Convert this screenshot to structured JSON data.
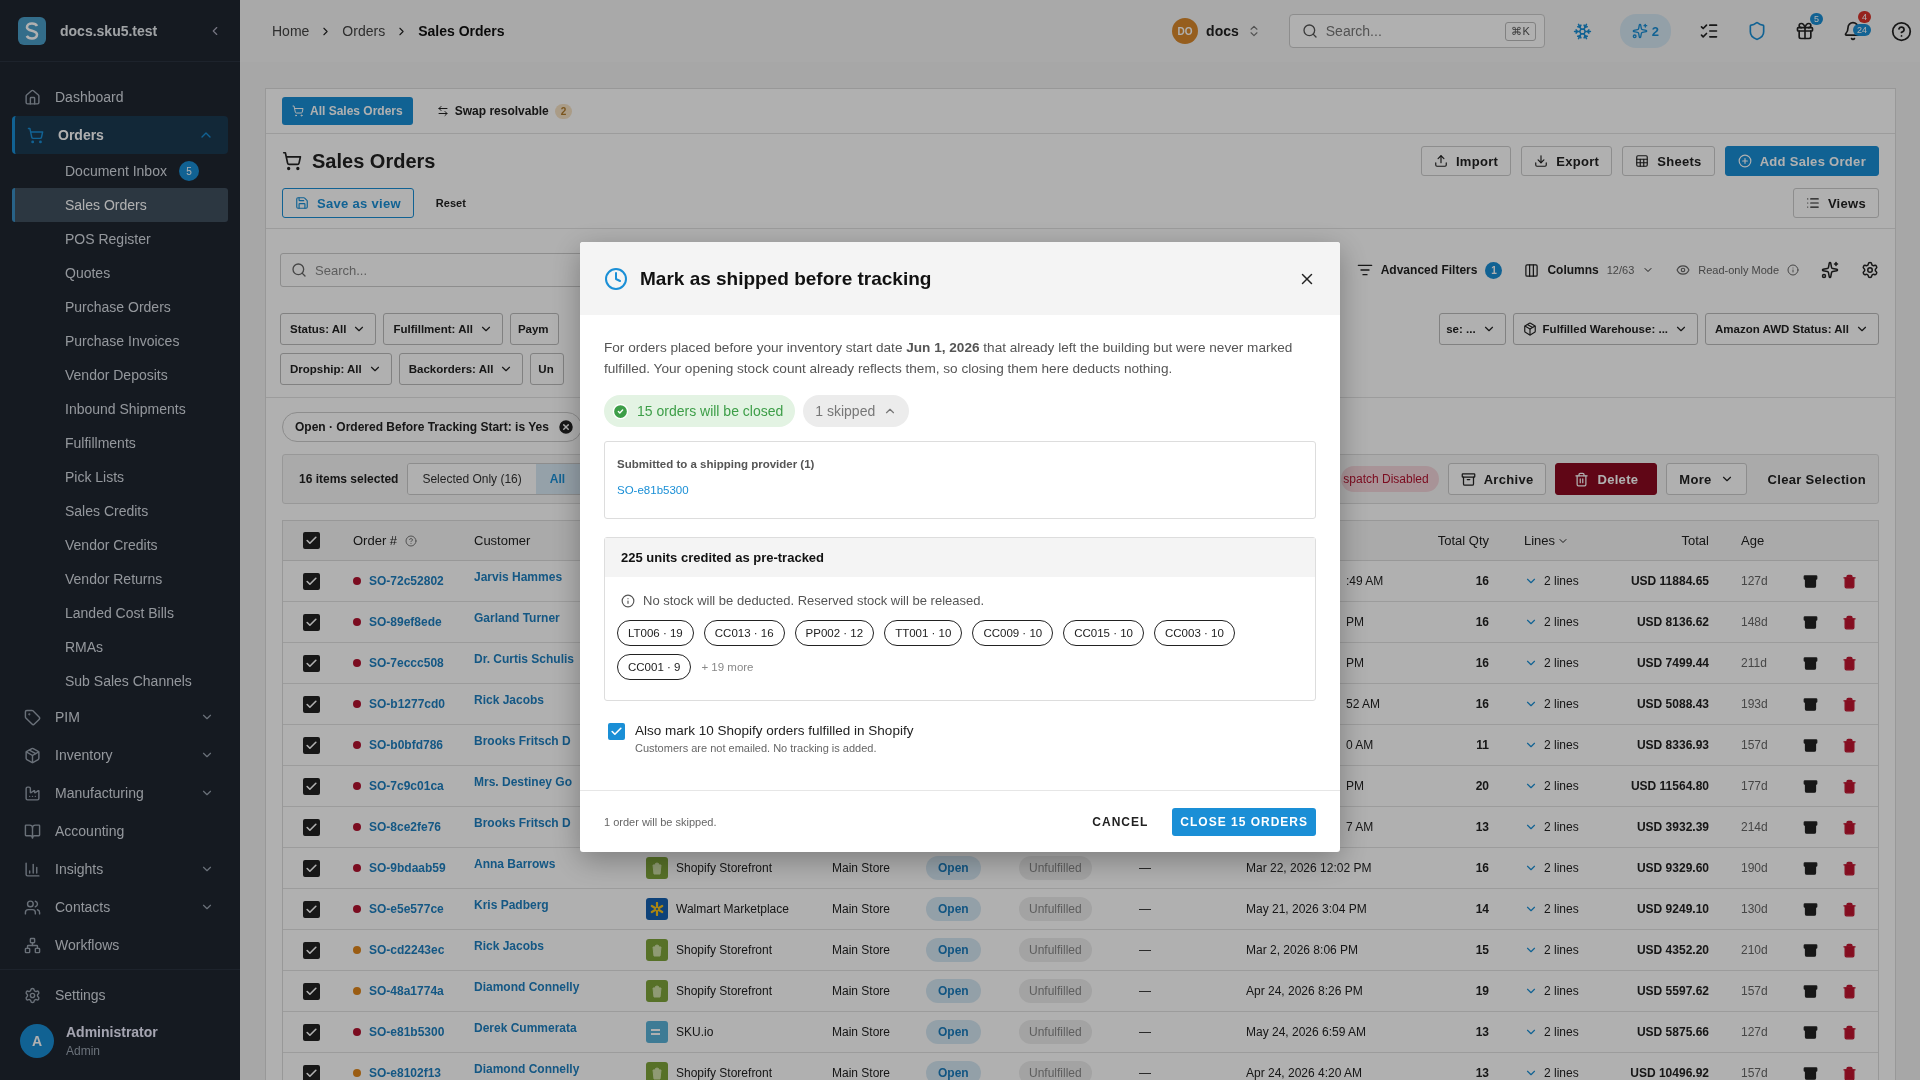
{
  "sidebar": {
    "workspace": "docs.sku5.test",
    "items": [
      {
        "label": "Dashboard",
        "selected": false
      },
      {
        "label": "Orders",
        "selected": true,
        "expanded": true,
        "children": [
          {
            "label": "Document Inbox",
            "badge": "5",
            "selected": false
          },
          {
            "label": "Sales Orders",
            "selected": true
          },
          {
            "label": "POS Register",
            "selected": false
          },
          {
            "label": "Quotes",
            "selected": false
          },
          {
            "label": "Purchase Orders",
            "selected": false
          },
          {
            "label": "Purchase Invoices",
            "selected": false
          },
          {
            "label": "Vendor Deposits",
            "selected": false
          },
          {
            "label": "Inbound Shipments",
            "selected": false
          },
          {
            "label": "Fulfillments",
            "selected": false
          },
          {
            "label": "Pick Lists",
            "selected": false
          },
          {
            "label": "Sales Credits",
            "selected": false
          },
          {
            "label": "Vendor Credits",
            "selected": false
          },
          {
            "label": "Vendor Returns",
            "selected": false
          },
          {
            "label": "Landed Cost Bills",
            "selected": false
          },
          {
            "label": "RMAs",
            "selected": false
          },
          {
            "label": "Sub Sales Channels",
            "selected": false
          }
        ]
      },
      {
        "label": "PIM",
        "selected": false,
        "expanded": false
      },
      {
        "label": "Inventory",
        "selected": false,
        "expanded": false
      },
      {
        "label": "Manufacturing",
        "selected": false,
        "expanded": false
      },
      {
        "label": "Accounting",
        "selected": false
      },
      {
        "label": "Insights",
        "selected": false,
        "expanded": false
      },
      {
        "label": "Contacts",
        "selected": false,
        "expanded": false
      },
      {
        "label": "Workflows",
        "selected": false
      }
    ],
    "settings": "Settings",
    "user": {
      "initial": "A",
      "name": "Administrator",
      "role": "Admin"
    }
  },
  "topbar": {
    "breadcrumbs": [
      "Home",
      "Orders",
      "Sales Orders"
    ],
    "workspace": {
      "initials": "DO",
      "name": "docs"
    },
    "search": {
      "placeholder": "Search...",
      "shortcut": "⌘K"
    },
    "ai_count": "2",
    "gift_badge": "5",
    "bell_badges": [
      "4",
      "24"
    ]
  },
  "page": {
    "tabs": [
      {
        "label": "All Sales Orders",
        "selected": true
      },
      {
        "label": "Swap resolvable",
        "count": "2",
        "selected": false
      }
    ],
    "title": "Sales Orders",
    "header_buttons": [
      {
        "label": "Import",
        "kind": "outline"
      },
      {
        "label": "Export",
        "kind": "outline"
      },
      {
        "label": "Sheets",
        "kind": "outline"
      },
      {
        "label": "Add Sales Order",
        "kind": "primary"
      }
    ],
    "save_view": "Save as view",
    "reset": "Reset",
    "views": "Views",
    "toolbar": {
      "placeholder": "Search...",
      "advanced_filters": "Advanced Filters",
      "filter_count": "1",
      "columns": "Columns",
      "columns_count": "12/63",
      "read_only": "Read-only Mode"
    },
    "filters_left": [
      [
        "Status: All",
        "Fulfillment: All",
        "Paym"
      ],
      [
        "Dropship: All",
        "Backorders: All",
        "Un"
      ]
    ],
    "filters_right": [
      "se: ...",
      "Fulfilled Warehouse: ...",
      "Amazon AWD Status: All"
    ],
    "active_filter": "Open · Ordered Before Tracking Start: is Yes",
    "bulk": {
      "count_label": "16 items selected",
      "scopes": [
        {
          "label": "Selected Only (16)",
          "selected": false
        },
        {
          "label": "All",
          "selected": true
        }
      ],
      "dispatch": "spatch Disabled",
      "actions": [
        {
          "label": "Archive",
          "kind": "outline"
        },
        {
          "label": "Delete",
          "kind": "danger"
        },
        {
          "label": "More",
          "kind": "menu"
        },
        {
          "label": "Clear Selection",
          "kind": "text"
        }
      ]
    },
    "table": {
      "all_checked": true,
      "columns": {
        "order": "Order #",
        "customer": "Customer",
        "qty": "Total Qty",
        "lines": "Lines",
        "total": "Total",
        "age": "Age"
      },
      "rows": [
        {
          "order": "SO-72c52802",
          "color": "#7b0c20",
          "customer": "Jarvis Hammes",
          "covered": true,
          "date": ":49 AM",
          "qty": "16",
          "lines": "2 lines",
          "total": "USD 11884.65",
          "age": "127d",
          "checked": true
        },
        {
          "order": "SO-89ef8ede",
          "color": "#7b0c20",
          "customer": "Garland Turner",
          "covered": true,
          "date": "PM",
          "qty": "16",
          "lines": "2 lines",
          "total": "USD 8136.62",
          "age": "148d",
          "checked": true
        },
        {
          "order": "SO-7eccc508",
          "color": "#7b0c20",
          "customer": "Dr. Curtis Schulis",
          "covered": true,
          "date": "PM",
          "qty": "16",
          "lines": "2 lines",
          "total": "USD 7499.44",
          "age": "211d",
          "checked": true
        },
        {
          "order": "SO-b1277cd0",
          "color": "#7b0c20",
          "customer": "Rick Jacobs",
          "covered": true,
          "date": "52 AM",
          "qty": "16",
          "lines": "2 lines",
          "total": "USD 5088.43",
          "age": "193d",
          "checked": true
        },
        {
          "order": "SO-b0bfd786",
          "color": "#7b0c20",
          "customer": "Brooks Fritsch D",
          "covered": true,
          "date": "0 AM",
          "qty": "11",
          "lines": "2 lines",
          "total": "USD 8336.93",
          "age": "157d",
          "checked": true
        },
        {
          "order": "SO-7c9c01ca",
          "color": "#7b0c20",
          "customer": "Mrs. Destiney Go",
          "covered": true,
          "date": "PM",
          "qty": "20",
          "lines": "2 lines",
          "total": "USD 11564.80",
          "age": "177d",
          "checked": true
        },
        {
          "order": "SO-8ce2fe76",
          "color": "#7b0c20",
          "customer": "Brooks Fritsch D",
          "covered": true,
          "date": "7 AM",
          "qty": "13",
          "lines": "2 lines",
          "total": "USD 3932.39",
          "age": "214d",
          "checked": true
        },
        {
          "order": "SO-9bdaab59",
          "color": "#7b0c20",
          "customer": "Anna Barrows",
          "covered": false,
          "kind": "shopify",
          "channel": "Shopify Storefront",
          "store": "Main Store",
          "status": "Open",
          "fulfillment": "Unfulfilled",
          "tracking": "—",
          "date": "Mar 22, 2026 12:02 PM",
          "qty": "16",
          "lines": "2 lines",
          "total": "USD 9329.60",
          "age": "190d",
          "checked": true
        },
        {
          "order": "SO-e5e577ce",
          "color": "#7b0c20",
          "customer": "Kris Padberg",
          "covered": false,
          "kind": "walmart",
          "channel": "Walmart Marketplace",
          "store": "Main Store",
          "status": "Open",
          "fulfillment": "Unfulfilled",
          "tracking": "—",
          "date": "May 21, 2026 3:04 PM",
          "qty": "14",
          "lines": "2 lines",
          "total": "USD 9249.10",
          "age": "130d",
          "checked": true
        },
        {
          "order": "SO-cd2243ec",
          "color": "#9a5c12",
          "customer": "Rick Jacobs",
          "covered": false,
          "kind": "shopify",
          "channel": "Shopify Storefront",
          "store": "Main Store",
          "status": "Open",
          "fulfillment": "Unfulfilled",
          "tracking": "—",
          "date": "Mar 2, 2026 8:06 PM",
          "qty": "15",
          "lines": "2 lines",
          "total": "USD 4352.20",
          "age": "210d",
          "checked": true
        },
        {
          "order": "SO-48a1774a",
          "color": "#9a5c12",
          "customer": "Diamond Connelly",
          "covered": false,
          "kind": "shopify",
          "channel": "Shopify Storefront",
          "store": "Main Store",
          "status": "Open",
          "fulfillment": "Unfulfilled",
          "tracking": "—",
          "date": "Apr 24, 2026 8:26 PM",
          "qty": "19",
          "lines": "2 lines",
          "total": "USD 5597.62",
          "age": "157d",
          "checked": true
        },
        {
          "order": "SO-e81b5300",
          "color": "#7b0c20",
          "customer": "Derek Cummerata",
          "covered": false,
          "kind": "skuio",
          "channel": "SKU.io",
          "store": "Main Store",
          "status": "Open",
          "fulfillment": "Unfulfilled",
          "tracking": "—",
          "date": "May 24, 2026 6:59 AM",
          "qty": "13",
          "lines": "2 lines",
          "total": "USD 5875.66",
          "age": "127d",
          "checked": true
        },
        {
          "order": "SO-e8102f13",
          "color": "#9a5c12",
          "customer": "Diamond Connelly",
          "covered": false,
          "kind": "shopify",
          "channel": "Shopify Storefront",
          "store": "Main Store",
          "status": "Open",
          "fulfillment": "Unfulfilled",
          "tracking": "—",
          "date": "Apr 24, 2026 4:20 AM",
          "qty": "13",
          "lines": "2 lines",
          "total": "USD 10496.92",
          "age": "157d",
          "checked": true
        }
      ]
    }
  },
  "modal": {
    "title": "Mark as shipped before tracking",
    "intro": "For orders placed before your inventory start date **Jun 1, 2026** that already left the building but were never marked fulfilled. Your opening stock count already reflects them, so closing them here deducts nothing.",
    "closing": "15 orders will be closed",
    "skipped": {
      "label": "1 skipped",
      "expanded": true
    },
    "skipped_group": {
      "heading": "Submitted to a shipping provider (1)",
      "orders": [
        "SO-e81b5300"
      ]
    },
    "credits": {
      "heading": "225 units credited as pre-tracked",
      "note": "No stock will be deducted. Reserved stock will be released.",
      "items": [
        "LT006 · 19",
        "CC013 · 16",
        "PP002 · 12",
        "TT001 · 10",
        "CC009 · 10",
        "CC015 · 10",
        "CC003 · 10",
        "CC001 · 9"
      ],
      "more": "+ 19 more"
    },
    "shopify_option": {
      "label": "Also mark 10 Shopify orders fulfilled in Shopify",
      "hint": "Customers are not emailed. No tracking is added.",
      "checked": true
    },
    "footer_note": "1 order will be skipped.",
    "buttons": [
      {
        "label": "CANCEL",
        "kind": "text"
      },
      {
        "label": "CLOSE 15 ORDERS",
        "kind": "primary"
      }
    ]
  }
}
